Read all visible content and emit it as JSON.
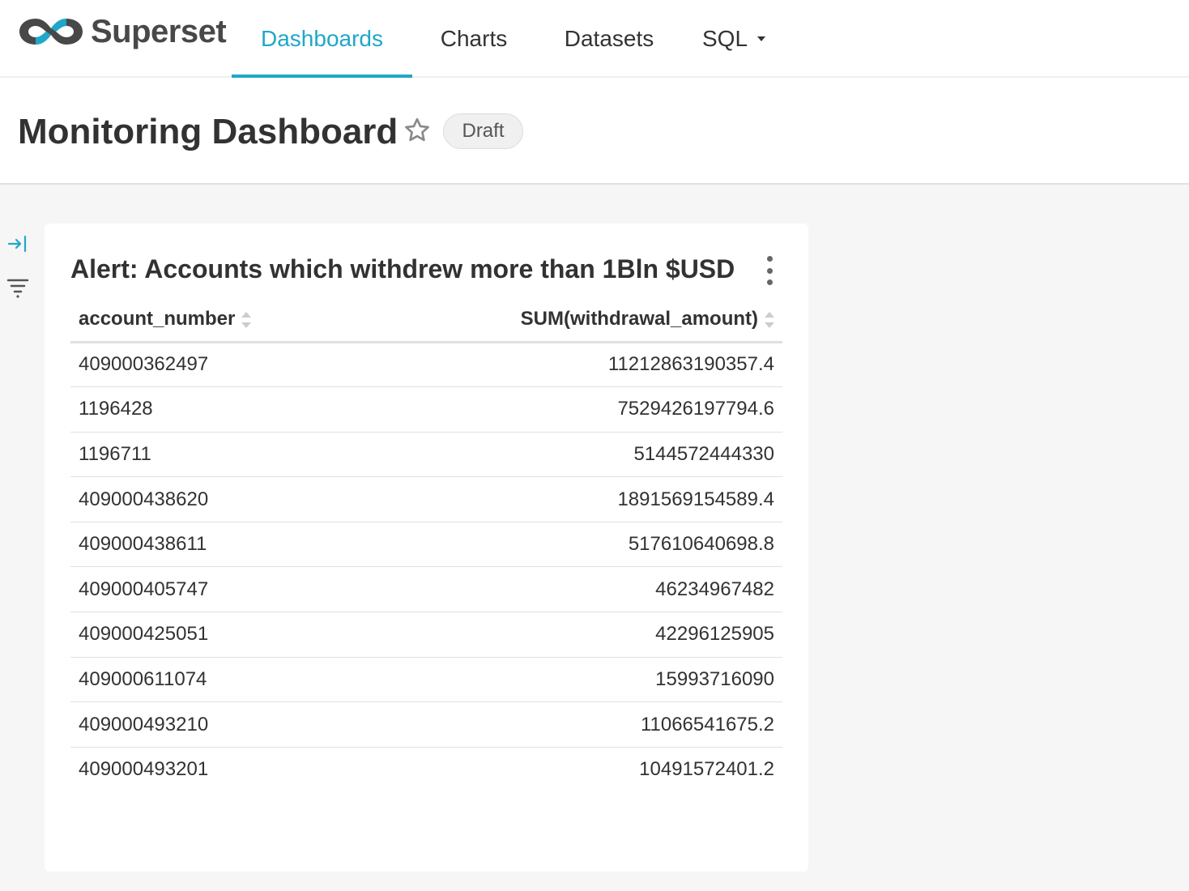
{
  "nav": {
    "brand": "Superset",
    "items": [
      {
        "label": "Dashboards",
        "active": true
      },
      {
        "label": "Charts",
        "active": false
      },
      {
        "label": "Datasets",
        "active": false
      },
      {
        "label": "SQL",
        "active": false,
        "has_dropdown": true
      }
    ]
  },
  "header": {
    "title": "Monitoring Dashboard",
    "favorite_icon": "star-outline-icon",
    "status_badge": "Draft"
  },
  "sidebar": {
    "icons": [
      "expand-panel-icon",
      "filter-icon"
    ]
  },
  "card": {
    "title": "Alert: Accounts which withdrew more than 1Bln $USD",
    "menu_icon": "more-vertical-icon",
    "table": {
      "columns": [
        "account_number",
        "SUM(withdrawal_amount)"
      ],
      "rows": [
        [
          "409000362497",
          "11212863190357.4"
        ],
        [
          "1196428",
          "7529426197794.6"
        ],
        [
          "1196711",
          "5144572444330"
        ],
        [
          "409000438620",
          "1891569154589.4"
        ],
        [
          "409000438611",
          "517610640698.8"
        ],
        [
          "409000405747",
          "46234967482"
        ],
        [
          "409000425051",
          "42296125905"
        ],
        [
          "409000611074",
          "15993716090"
        ],
        [
          "409000493210",
          "11066541675.2"
        ],
        [
          "409000493201",
          "10491572401.2"
        ]
      ]
    }
  },
  "colors": {
    "accent": "#20a7c9",
    "text": "#323232",
    "background": "#f6f6f6"
  }
}
